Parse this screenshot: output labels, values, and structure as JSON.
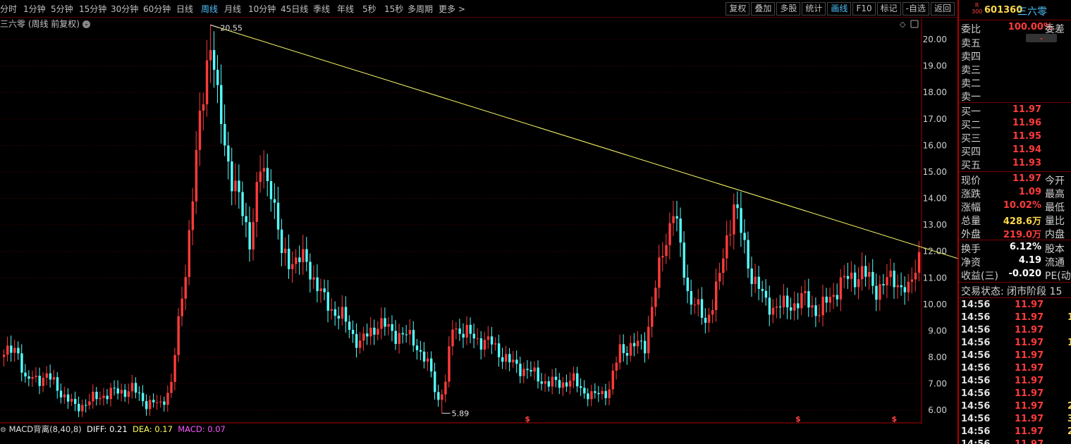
{
  "toolbar": {
    "periods": [
      "分时",
      "1分钟",
      "5分钟",
      "15分钟",
      "30分钟",
      "60分钟",
      "日线",
      "周线",
      "月线",
      "10分钟",
      "45日线",
      "季线",
      "年线",
      "5秒",
      "15秒",
      "多周期",
      "更多 >"
    ],
    "active_period": "周线",
    "tools": [
      "复权",
      "叠加",
      "多股",
      "统计",
      "画线",
      "F10",
      "标记",
      "-自选",
      "返回"
    ],
    "active_tool": "画线"
  },
  "chart_header": {
    "title": "三六零 (周线 前复权)"
  },
  "macd": {
    "label": "MACD背离(8,40,8)",
    "diff": "DIFF: 0.21",
    "dea": "DEA: 0.17",
    "macd": "MACD: 0.07"
  },
  "chart_data": {
    "type": "candlestick",
    "ylim": [
      5.5,
      20.8
    ],
    "y_ticks": [
      "20.00",
      "19.00",
      "18.00",
      "17.00",
      "16.00",
      "15.00",
      "14.00",
      "13.00",
      "12.00",
      "11.00",
      "10.00",
      "9.00",
      "8.00",
      "7.00",
      "6.00"
    ],
    "annotations": {
      "high": "20.55",
      "low": "5.89"
    },
    "trendline": {
      "from_index": 58,
      "from_value": 20.55,
      "to_index": 269,
      "to_value": 11.7
    },
    "markers": {
      "symbol": "$",
      "indices": [
        147,
        223,
        250
      ]
    },
    "colors": {
      "up": "#ff3b3b",
      "down": "#54ffff",
      "trend": "#ffff66",
      "grid": "#5a0000"
    },
    "control_points": [
      [
        0,
        8.1
      ],
      [
        4,
        8.3
      ],
      [
        6,
        7.1
      ],
      [
        12,
        7.3
      ],
      [
        20,
        6.1
      ],
      [
        28,
        6.6
      ],
      [
        36,
        6.8
      ],
      [
        40,
        6.3
      ],
      [
        44,
        6.2
      ],
      [
        47,
        7.0
      ],
      [
        51,
        11.4
      ],
      [
        55,
        16.8
      ],
      [
        58,
        20.55
      ],
      [
        60,
        17.5
      ],
      [
        64,
        14.8
      ],
      [
        69,
        12.5
      ],
      [
        72,
        15.0
      ],
      [
        75,
        14.6
      ],
      [
        78,
        11.8
      ],
      [
        85,
        11.6
      ],
      [
        90,
        10.1
      ],
      [
        95,
        9.5
      ],
      [
        100,
        8.5
      ],
      [
        105,
        9.3
      ],
      [
        110,
        8.9
      ],
      [
        115,
        8.7
      ],
      [
        120,
        7.4
      ],
      [
        123,
        5.89
      ],
      [
        126,
        9.2
      ],
      [
        131,
        8.8
      ],
      [
        137,
        8.5
      ],
      [
        142,
        7.8
      ],
      [
        147,
        7.5
      ],
      [
        153,
        7.0
      ],
      [
        160,
        7.1
      ],
      [
        165,
        6.5
      ],
      [
        170,
        6.8
      ],
      [
        173,
        8.3
      ],
      [
        180,
        8.5
      ],
      [
        185,
        12.0
      ],
      [
        188,
        13.6
      ],
      [
        192,
        10.5
      ],
      [
        197,
        9.3
      ],
      [
        201,
        11.0
      ],
      [
        205,
        13.9
      ],
      [
        209,
        11.5
      ],
      [
        214,
        10.0
      ],
      [
        219,
        9.9
      ],
      [
        225,
        10.2
      ],
      [
        229,
        9.7
      ],
      [
        235,
        10.8
      ],
      [
        241,
        11.2
      ],
      [
        245,
        10.6
      ],
      [
        250,
        11.0
      ],
      [
        254,
        10.4
      ],
      [
        257,
        11.97
      ]
    ],
    "count": 258
  },
  "quote": {
    "code": "601360",
    "name": "三六零",
    "badge_top": "R",
    "badge_bottom": "300",
    "weibi_label": "委比",
    "weibi_value": "100.00%",
    "weicha_label": "委差",
    "sells": [
      "卖五",
      "卖四",
      "卖三",
      "卖二",
      "卖一"
    ],
    "buys": [
      {
        "label": "买一",
        "price": "11.97"
      },
      {
        "label": "买二",
        "price": "11.96"
      },
      {
        "label": "买三",
        "price": "11.95"
      },
      {
        "label": "买四",
        "price": "11.94"
      },
      {
        "label": "买五",
        "price": "11.93"
      }
    ],
    "stats": [
      {
        "label": "现价",
        "value": "11.97",
        "right": "今开",
        "color": "#ff3b3b"
      },
      {
        "label": "涨跌",
        "value": "1.09",
        "right": "最高",
        "color": "#ff3b3b"
      },
      {
        "label": "涨幅",
        "value": "10.02%",
        "right": "最低",
        "color": "#ff3b3b"
      },
      {
        "label": "总量",
        "value": "428.6万",
        "right": "量比",
        "color": "#ffd84a"
      },
      {
        "label": "外盘",
        "value": "219.0万",
        "right": "内盘",
        "color": "#ff3b3b"
      }
    ],
    "stats2": [
      {
        "label": "换手",
        "value": "6.12%",
        "right": "股本",
        "color": "#ffffff"
      },
      {
        "label": "净资",
        "value": "4.19",
        "right": "流通",
        "color": "#ffffff"
      },
      {
        "label": "收益(三)",
        "value": "-0.020",
        "right": "PE(动)",
        "color": "#ffffff"
      }
    ],
    "status": "交易状态: 闭市阶段 15",
    "ticks": [
      {
        "time": "14:56",
        "price": "11.97",
        "q": ""
      },
      {
        "time": "14:56",
        "price": "11.97",
        "q": "1"
      },
      {
        "time": "14:56",
        "price": "11.97",
        "q": ""
      },
      {
        "time": "14:56",
        "price": "11.97",
        "q": "1"
      },
      {
        "time": "14:56",
        "price": "11.97",
        "q": ""
      },
      {
        "time": "14:56",
        "price": "11.97",
        "q": ""
      },
      {
        "time": "14:56",
        "price": "11.97",
        "q": ""
      },
      {
        "time": "14:56",
        "price": "11.97",
        "q": ""
      },
      {
        "time": "14:56",
        "price": "11.97",
        "q": "2"
      },
      {
        "time": "14:56",
        "price": "11.97",
        "q": "3"
      },
      {
        "time": "14:56",
        "price": "11.97",
        "q": "2"
      },
      {
        "time": "14:56",
        "price": "11.97",
        "q": ""
      }
    ]
  }
}
